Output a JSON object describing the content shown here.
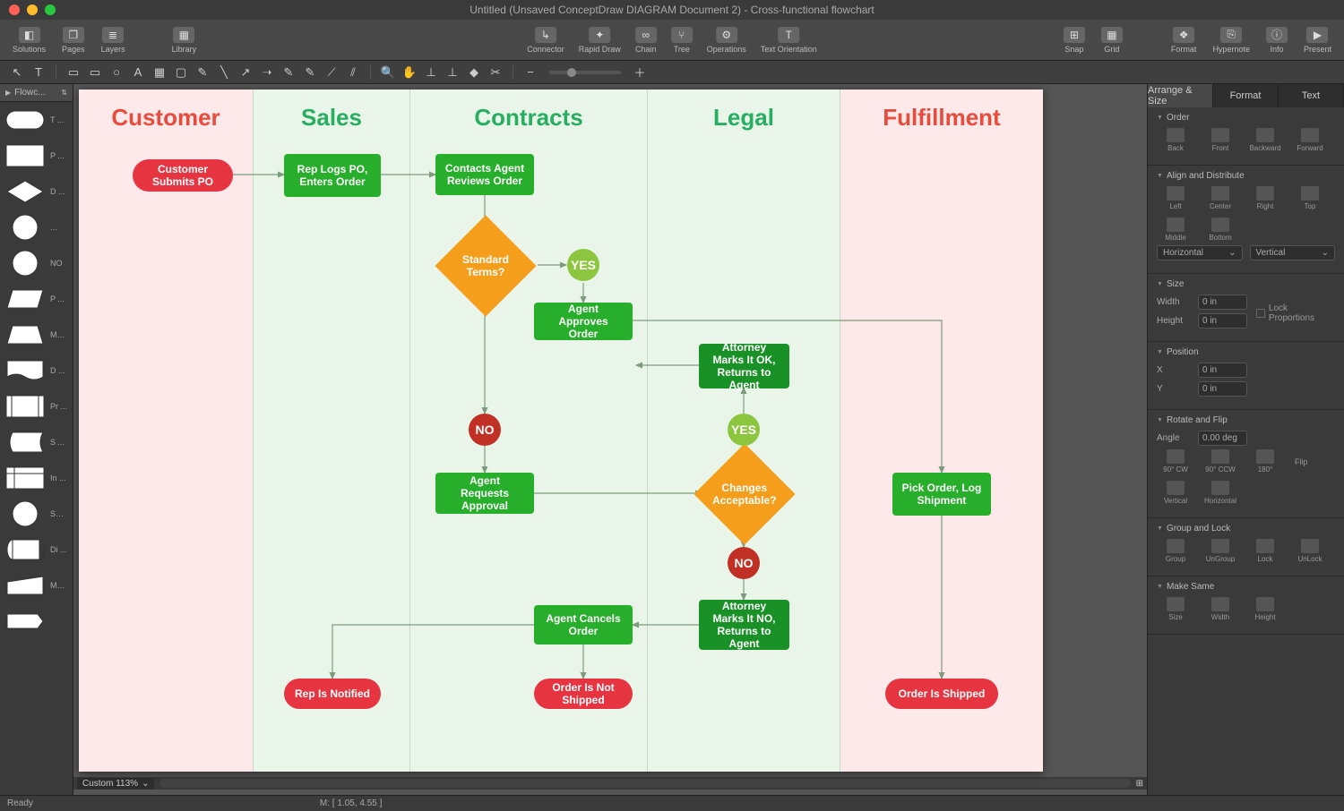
{
  "title": "Untitled (Unsaved ConceptDraw DIAGRAM Document 2) - Cross-functional flowchart",
  "toolbar": {
    "left": [
      {
        "label": "Solutions",
        "icon": "◧"
      },
      {
        "label": "Pages",
        "icon": "❐"
      },
      {
        "label": "Layers",
        "icon": "≣"
      }
    ],
    "library": {
      "label": "Library",
      "icon": "▦"
    },
    "center": [
      {
        "label": "Connector",
        "icon": "↳"
      },
      {
        "label": "Rapid Draw",
        "icon": "✦"
      },
      {
        "label": "Chain",
        "icon": "∞"
      },
      {
        "label": "Tree",
        "icon": "⑂"
      },
      {
        "label": "Operations",
        "icon": "⚙"
      },
      {
        "label": "Text Orientation",
        "icon": "T"
      }
    ],
    "right_a": [
      {
        "label": "Snap",
        "icon": "⊞"
      },
      {
        "label": "Grid",
        "icon": "▦"
      }
    ],
    "right_b": [
      {
        "label": "Format",
        "icon": "❖"
      },
      {
        "label": "Hypernote",
        "icon": "⎘"
      },
      {
        "label": "Info",
        "icon": "ⓘ"
      },
      {
        "label": "Present",
        "icon": "▶"
      }
    ]
  },
  "sec_toolbar": {
    "tools_a": [
      "↖",
      "T"
    ],
    "tools_b": [
      "▭",
      "▭",
      "○",
      "A",
      "▦",
      "▢",
      "✎",
      "╲",
      "↗",
      "➝",
      "✎",
      "✎",
      "⟋",
      "⫽"
    ],
    "tools_c": [
      "🔍",
      "✋",
      "⊥",
      "⊥",
      "◆",
      "✂"
    ],
    "zoom_minus": "−",
    "zoom_plus": "＋"
  },
  "library": {
    "header": "Flowc...",
    "shapes": [
      {
        "name": "T ...",
        "svg": "pill"
      },
      {
        "name": "P ...",
        "svg": "rect"
      },
      {
        "name": "D ...",
        "svg": "diamond"
      },
      {
        "name": "...",
        "svg": "circle"
      },
      {
        "name": "NO",
        "svg": "circle"
      },
      {
        "name": "P ...",
        "svg": "parallelogram"
      },
      {
        "name": "Ma ...",
        "svg": "trapezoid"
      },
      {
        "name": "D ...",
        "svg": "doc"
      },
      {
        "name": "Pr ...",
        "svg": "predef"
      },
      {
        "name": "S ...",
        "svg": "stored"
      },
      {
        "name": "In ...",
        "svg": "internal"
      },
      {
        "name": "Se ...",
        "svg": "circle"
      },
      {
        "name": "Di ...",
        "svg": "cylinder"
      },
      {
        "name": "Ma ...",
        "svg": "manual"
      },
      {
        "name": "",
        "svg": "terminator"
      }
    ]
  },
  "flowchart": {
    "lanes": [
      {
        "title": "Customer",
        "color": "red",
        "bg": "pink"
      },
      {
        "title": "Sales",
        "color": "green",
        "bg": "lgreen"
      },
      {
        "title": "Contracts",
        "color": "green",
        "bg": "lgreen"
      },
      {
        "title": "Legal",
        "color": "green",
        "bg": "lgreen"
      },
      {
        "title": "Fulfillment",
        "color": "red",
        "bg": "pink"
      }
    ],
    "nodes": {
      "start": "Customer Submits PO",
      "rep_logs": "Rep Logs PO, Enters Order",
      "contacts_agent": "Contacts Agent Reviews Order",
      "standard_terms": "Standard Terms?",
      "yes1": "YES",
      "agent_approves": "Agent Approves Order",
      "attorney_ok": "Attorney Marks It OK, Returns to Agent",
      "no1": "NO",
      "agent_requests": "Agent Requests Approval",
      "changes": "Changes Acceptable?",
      "yes2": "YES",
      "no2": "NO",
      "attorney_no": "Attorney Marks It NO, Returns to Agent",
      "agent_cancels": "Agent Cancels Order",
      "rep_notified": "Rep Is Notified",
      "order_not_shipped": "Order Is Not Shipped",
      "pick_order": "Pick Order, Log Shipment",
      "order_shipped": "Order Is Shipped"
    }
  },
  "right_panel": {
    "tabs": [
      "Arrange & Size",
      "Format",
      "Text"
    ],
    "sections": {
      "order": {
        "title": "Order",
        "buttons": [
          "Back",
          "Front",
          "Backward",
          "Forward"
        ]
      },
      "align": {
        "title": "Align and Distribute",
        "buttons_h": [
          "Left",
          "Center",
          "Right"
        ],
        "buttons_v": [
          "Top",
          "Middle",
          "Bottom"
        ],
        "combo_h": "Horizontal",
        "combo_v": "Vertical"
      },
      "size": {
        "title": "Size",
        "width_lbl": "Width",
        "width_val": "0 in",
        "height_lbl": "Height",
        "height_val": "0 in",
        "lock": "Lock Proportions"
      },
      "position": {
        "title": "Position",
        "x_lbl": "X",
        "x_val": "0 in",
        "y_lbl": "Y",
        "y_val": "0 in"
      },
      "rotate": {
        "title": "Rotate and Flip",
        "angle_lbl": "Angle",
        "angle_val": "0.00 deg",
        "buttons": [
          "90° CW",
          "90° CCW",
          "180°"
        ],
        "flip_lbl": "Flip",
        "flip_buttons": [
          "Vertical",
          "Horizontal"
        ]
      },
      "group": {
        "title": "Group and Lock",
        "buttons": [
          "Group",
          "UnGroup",
          "Lock",
          "UnLock"
        ]
      },
      "make_same": {
        "title": "Make Same",
        "buttons": [
          "Size",
          "Width",
          "Height"
        ]
      }
    }
  },
  "statusbar": {
    "ready": "Ready",
    "zoom": "Custom 113%",
    "mouse": "M: [ 1.05, 4.55 ]"
  }
}
